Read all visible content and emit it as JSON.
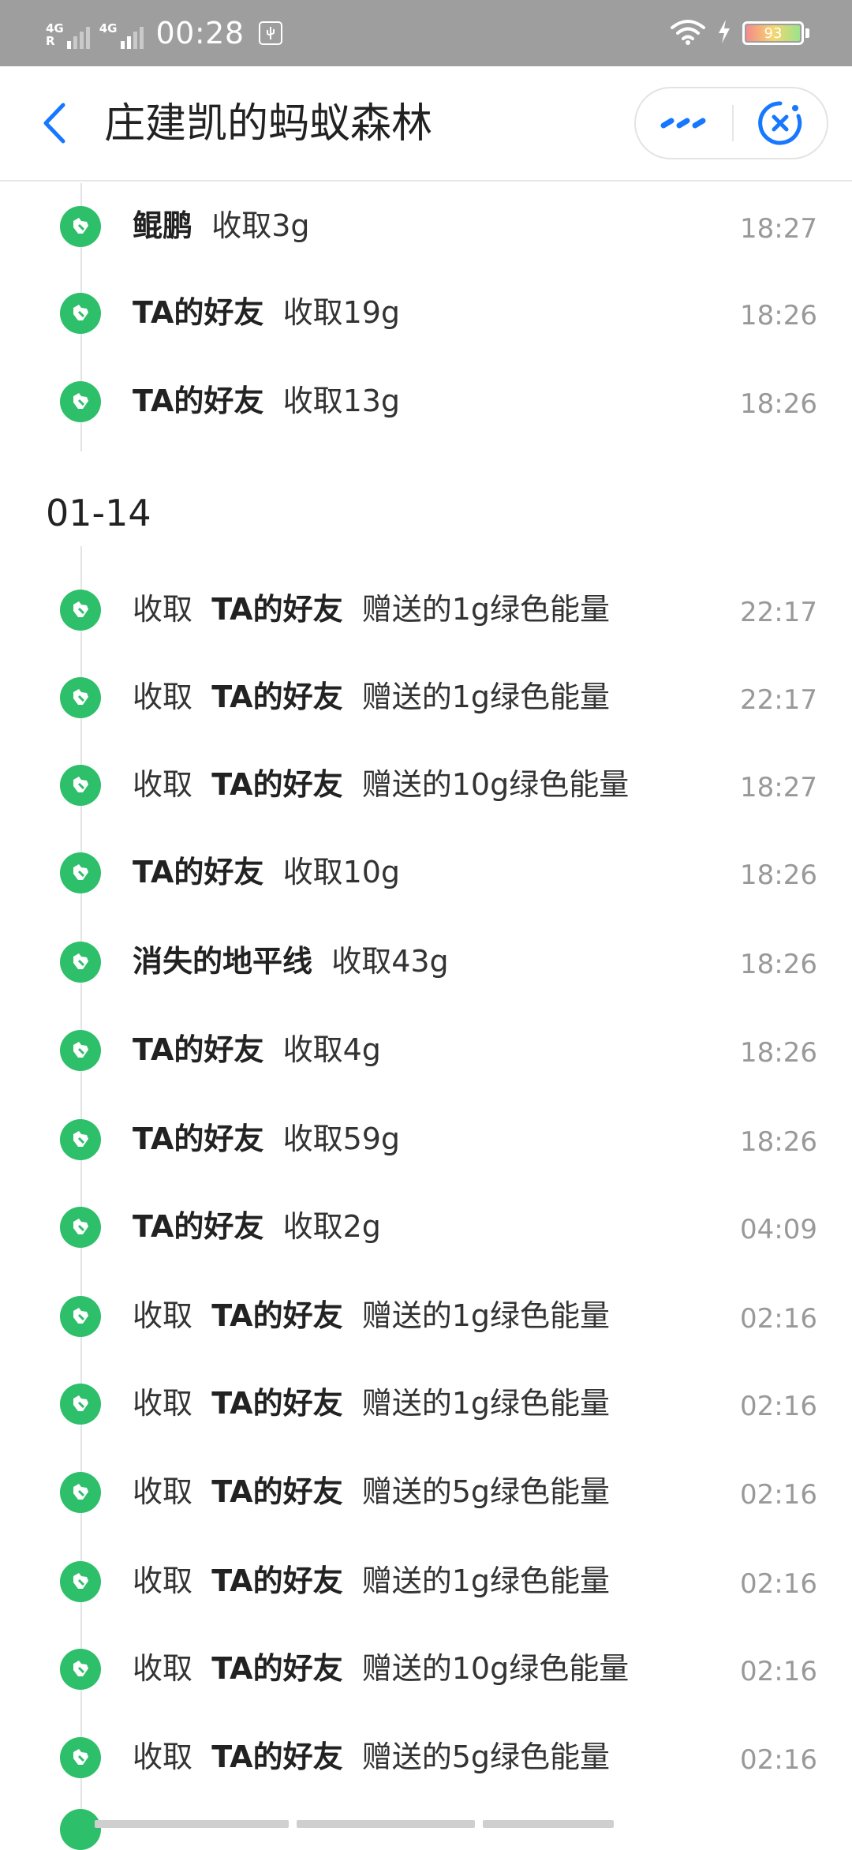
{
  "status_bar": {
    "net1": "4G",
    "net1_sub": "R",
    "net2": "4G",
    "time": "00:28",
    "battery": "93"
  },
  "header": {
    "title": "庄建凯的蚂蚁森林"
  },
  "colors": {
    "accent": "#1677ff",
    "dot_green": "#2dbf6a"
  },
  "section_1": {
    "items": [
      {
        "name": "鲲鹏",
        "text": "收取3g",
        "time": "18:27"
      },
      {
        "name": "TA的好友",
        "text": "收取19g",
        "time": "18:26"
      },
      {
        "name": "TA的好友",
        "text": "收取13g",
        "time": "18:26"
      }
    ]
  },
  "section_2": {
    "date": "01-14",
    "items": [
      {
        "prefix": "收取",
        "name": "TA的好友",
        "text": "赠送的1g绿色能量",
        "time": "22:17"
      },
      {
        "prefix": "收取",
        "name": "TA的好友",
        "text": "赠送的1g绿色能量",
        "time": "22:17"
      },
      {
        "prefix": "收取",
        "name": "TA的好友",
        "text": "赠送的10g绿色能量",
        "time": "18:27"
      },
      {
        "prefix": "",
        "name": "TA的好友",
        "text": "收取10g",
        "time": "18:26"
      },
      {
        "prefix": "",
        "name": "消失的地平线",
        "text": "收取43g",
        "time": "18:26"
      },
      {
        "prefix": "",
        "name": "TA的好友",
        "text": "收取4g",
        "time": "18:26"
      },
      {
        "prefix": "",
        "name": "TA的好友",
        "text": "收取59g",
        "time": "18:26"
      },
      {
        "prefix": "",
        "name": "TA的好友",
        "text": "收取2g",
        "time": "04:09"
      },
      {
        "prefix": "收取",
        "name": "TA的好友",
        "text": "赠送的1g绿色能量",
        "time": "02:16"
      },
      {
        "prefix": "收取",
        "name": "TA的好友",
        "text": "赠送的1g绿色能量",
        "time": "02:16"
      },
      {
        "prefix": "收取",
        "name": "TA的好友",
        "text": "赠送的5g绿色能量",
        "time": "02:16"
      },
      {
        "prefix": "收取",
        "name": "TA的好友",
        "text": "赠送的1g绿色能量",
        "time": "02:16"
      },
      {
        "prefix": "收取",
        "name": "TA的好友",
        "text": "赠送的10g绿色能量",
        "time": "02:16"
      },
      {
        "prefix": "收取",
        "name": "TA的好友",
        "text": "赠送的5g绿色能量",
        "time": "02:16"
      }
    ]
  }
}
